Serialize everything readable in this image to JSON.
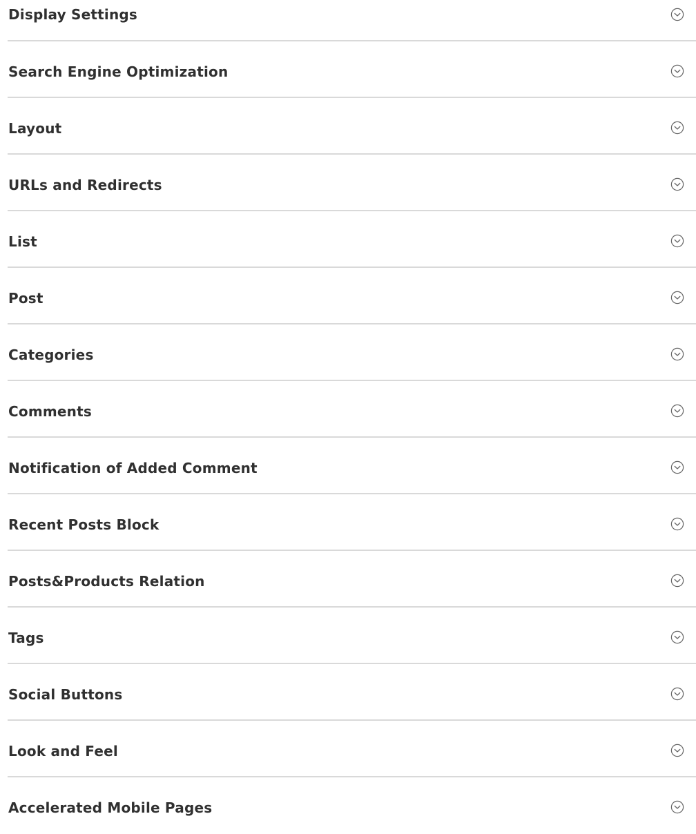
{
  "sections": [
    {
      "label": "Display Settings",
      "icon": "chevron-circle-down-icon"
    },
    {
      "label": "Search Engine Optimization",
      "icon": "chevron-circle-down-icon"
    },
    {
      "label": "Layout",
      "icon": "chevron-circle-down-icon"
    },
    {
      "label": "URLs and Redirects",
      "icon": "chevron-circle-down-icon"
    },
    {
      "label": "List",
      "icon": "chevron-circle-down-icon"
    },
    {
      "label": "Post",
      "icon": "chevron-circle-down-icon"
    },
    {
      "label": "Categories",
      "icon": "chevron-circle-down-icon"
    },
    {
      "label": "Comments",
      "icon": "chevron-circle-down-icon"
    },
    {
      "label": "Notification of Added Comment",
      "icon": "chevron-circle-down-icon"
    },
    {
      "label": "Recent Posts Block",
      "icon": "chevron-circle-down-icon"
    },
    {
      "label": "Posts&Products Relation",
      "icon": "chevron-circle-down-icon"
    },
    {
      "label": "Tags",
      "icon": "chevron-circle-down-icon"
    },
    {
      "label": "Social Buttons",
      "icon": "chevron-circle-down-icon"
    },
    {
      "label": "Look and Feel",
      "icon": "chevron-circle-down-icon"
    },
    {
      "label": "Accelerated Mobile Pages",
      "icon": "chevron-circle-down-icon"
    }
  ],
  "colors": {
    "text": "#303030",
    "divider": "#d9d9d9",
    "icon": "#666666",
    "background": "#ffffff"
  }
}
